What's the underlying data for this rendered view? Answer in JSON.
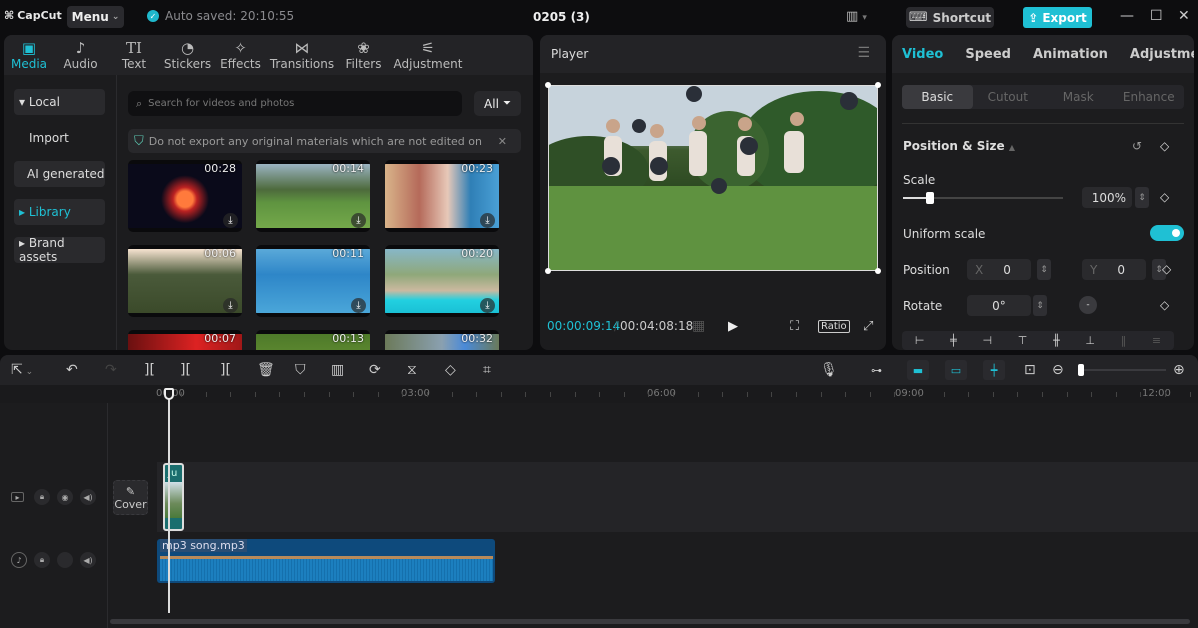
{
  "titlebar": {
    "app_name": "CapCut",
    "menu_label": "Menu",
    "autosave": "Auto saved: 20:10:55",
    "project_title": "0205 (3)",
    "shortcut_label": "Shortcut",
    "export_label": "Export",
    "colors": {
      "accent": "#1fc0d4"
    }
  },
  "media_panel": {
    "tabs": [
      {
        "label": "Media",
        "icon": "media-icon",
        "glyph": "▣",
        "active": true
      },
      {
        "label": "Audio",
        "icon": "audio-icon",
        "glyph": "♪",
        "active": false
      },
      {
        "label": "Text",
        "icon": "text-icon",
        "glyph": "TI",
        "active": false
      },
      {
        "label": "Stickers",
        "icon": "sticker-icon",
        "glyph": "◔",
        "active": false
      },
      {
        "label": "Effects",
        "icon": "effects-icon",
        "glyph": "✧",
        "active": false
      },
      {
        "label": "Transitions",
        "icon": "transitions-icon",
        "glyph": "⋈",
        "active": false
      },
      {
        "label": "Filters",
        "icon": "filters-icon",
        "glyph": "❀",
        "active": false
      },
      {
        "label": "Adjustment",
        "icon": "adjustment-icon",
        "glyph": "⚟",
        "active": false
      }
    ],
    "nav": [
      {
        "label": "▾ Local",
        "active": false,
        "bg": true
      },
      {
        "label": "Import",
        "active": false,
        "bg": false
      },
      {
        "label": "AI generated",
        "active": false,
        "bg": true
      },
      {
        "label": "▸ Library",
        "active": true,
        "bg": true
      },
      {
        "label": "▸ Brand assets",
        "active": false,
        "bg": true
      }
    ],
    "search_placeholder": "Search for videos and photos",
    "filter_label": "All",
    "notice": "Do not export any original materials which are not edited on CapCut",
    "thumbnails": [
      {
        "duration": "00:28",
        "scene": "fireworks"
      },
      {
        "duration": "00:14",
        "scene": "cheerleaders"
      },
      {
        "duration": "00:23",
        "scene": "friends-beach"
      },
      {
        "duration": "00:06",
        "scene": "forest-sunset"
      },
      {
        "duration": "00:11",
        "scene": "sea"
      },
      {
        "duration": "00:20",
        "scene": "pool"
      },
      {
        "duration": "00:07",
        "scene": "red-leaves"
      },
      {
        "duration": "00:13",
        "scene": "green-trees"
      },
      {
        "duration": "00:32",
        "scene": "sky-trees"
      }
    ]
  },
  "player": {
    "title": "Player",
    "current_time": "00:00:09:14",
    "total_time": "00:04:08:18",
    "ratio_label": "Ratio"
  },
  "properties": {
    "tabs": [
      "Video",
      "Speed",
      "Animation",
      "Adjustment"
    ],
    "active_tab": "Video",
    "subtabs": [
      "Basic",
      "Cutout",
      "Mask",
      "Enhance"
    ],
    "active_subtab": "Basic",
    "section_title": "Position & Size",
    "scale_label": "Scale",
    "scale_value": "100%",
    "scale_fraction": 0.17,
    "uniform_scale_label": "Uniform scale",
    "uniform_scale_on": true,
    "position_label": "Position",
    "pos_x_label": "X",
    "pos_x": "0",
    "pos_y_label": "Y",
    "pos_y": "0",
    "rotate_label": "Rotate",
    "rotate_value": "0°"
  },
  "timeline": {
    "ruler_labels": [
      "00:00",
      "03:00",
      "06:00",
      "09:00",
      "12:00"
    ],
    "cover_label": "Cover",
    "video_clip_label": "Ju",
    "audio_clip_label": "mp3 song.mp3"
  }
}
